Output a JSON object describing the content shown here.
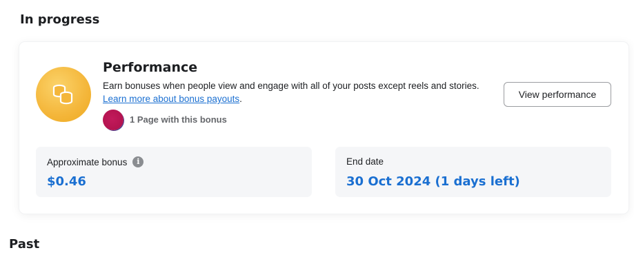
{
  "sections": {
    "in_progress_title": "In progress",
    "past_title": "Past"
  },
  "bonus_card": {
    "icon": "coins-icon",
    "title": "Performance",
    "description": "Earn bonuses when people view and engage with all of your posts except reels and stories.",
    "learn_more_link": "Learn more about bonus payouts",
    "learn_more_suffix": ".",
    "page_count_text": "1 Page with this bonus",
    "view_button_label": "View performance",
    "approximate_bonus": {
      "label": "Approximate bonus",
      "info_icon": "info-icon",
      "value": "$0.46"
    },
    "end_date": {
      "label": "End date",
      "value": "30 Oct 2024 (1 days left)"
    }
  },
  "colors": {
    "accent_blue": "#1a6fd1",
    "icon_gold": "#f4b63a",
    "avatar_magenta": "#b3134f",
    "stat_background": "#f5f6f8"
  }
}
